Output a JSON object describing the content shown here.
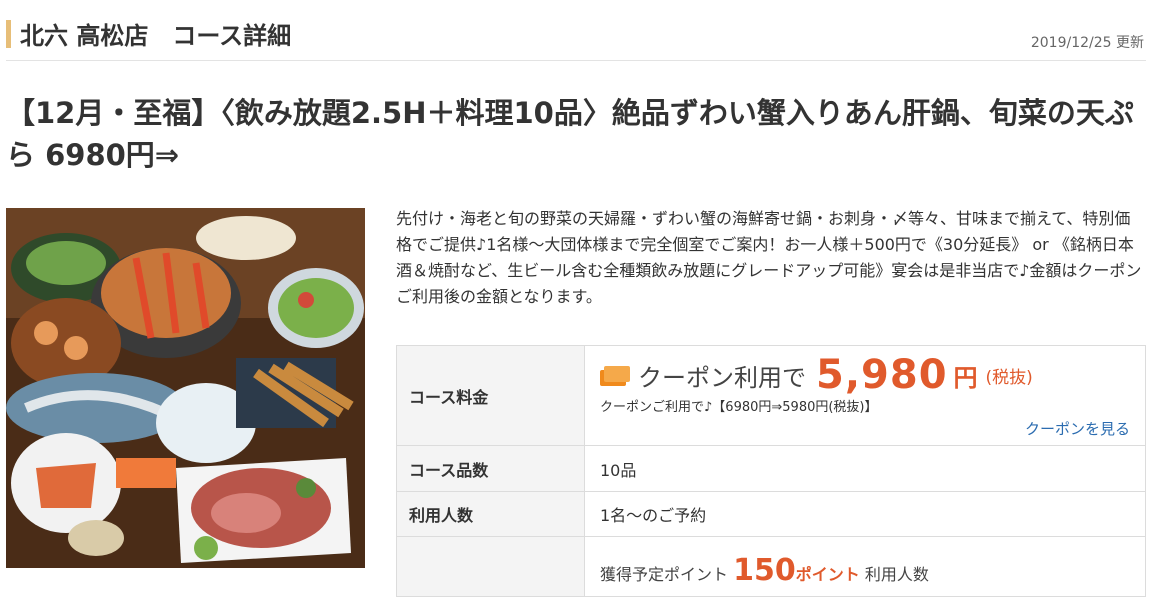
{
  "header": {
    "title": "北六 高松店　コース詳細",
    "updated": "2019/12/25 更新"
  },
  "course": {
    "title": "【12月・至福】〈飲み放題2.5H＋料理10品〉絶品ずわい蟹入りあん肝鍋、旬菜の天ぷら 6980円⇒",
    "description": "先付け・海老と旬の野菜の天婦羅・ずわい蟹の海鮮寄せ鍋・お刺身・〆等々、甘味まで揃えて、特別価格でご提供♪1名様～大団体様まで完全個室でご案内！お一人様＋500円で《30分延長》 or 《銘柄日本酒＆焼酎など、生ビール含む全種類飲み放題にグレードアップ可能》宴会は是非当店で♪金額はクーポンご利用後の金額となります。"
  },
  "info": {
    "price_label": "コース料金",
    "coupon_prefix": "クーポン利用で",
    "price_value": "5,980",
    "price_unit": "円",
    "price_tax": "(税抜)",
    "price_note": "クーポンご利用で♪【6980円⇒5980円(税抜)】",
    "coupon_link": "クーポンを見る",
    "items_label": "コース品数",
    "items_value": "10品",
    "people_label": "利用人数",
    "people_value": "1名～のご予約",
    "points_prefix": "獲得予定ポイント",
    "points_value": "150",
    "points_unit": "ポイント",
    "points_suffix": "利用人数"
  },
  "colors": {
    "accent": "#e7be78",
    "price": "#e05a2c",
    "link": "#2b6cb0"
  }
}
